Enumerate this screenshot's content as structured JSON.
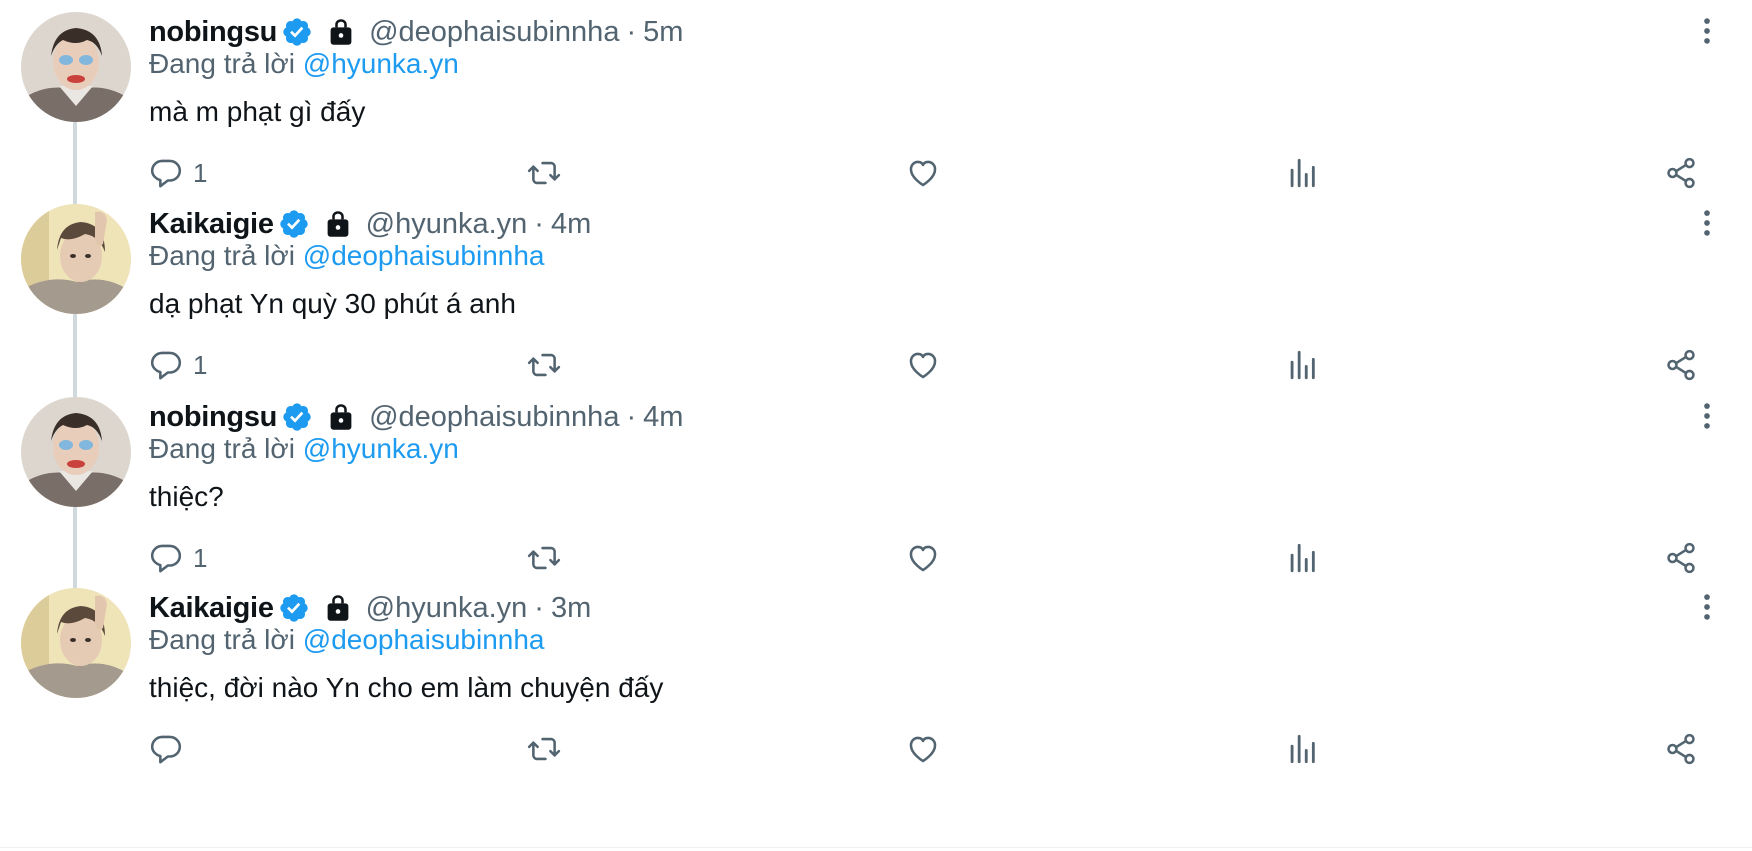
{
  "colors": {
    "accent": "#1d9bf0",
    "secondary_text": "#536471",
    "primary_text": "#0f1419",
    "thread_line": "#cfd9de"
  },
  "icons": {
    "verified": "verified-badge-icon",
    "protected": "lock-icon",
    "more": "more-vertical-icon",
    "reply": "reply-icon",
    "retweet": "retweet-icon",
    "like": "heart-icon",
    "views": "views-icon",
    "share": "share-icon"
  },
  "tweets": [
    {
      "display_name": "nobingsu",
      "handle": "@deophaisubinnha",
      "separator": "·",
      "time": "5m",
      "reply_prefix": "Đang trả lời",
      "reply_to": "@hyunka.yn",
      "text": "mà m phạt gì đấy",
      "reply_count": "1",
      "retweet_count": "",
      "like_count": "",
      "view_count": ""
    },
    {
      "display_name": "Kaikaigie",
      "handle": "@hyunka.yn",
      "separator": "·",
      "time": "4m",
      "reply_prefix": "Đang trả lời",
      "reply_to": "@deophaisubinnha",
      "text": "dạ phạt Yn quỳ 30 phút á anh",
      "reply_count": "1",
      "retweet_count": "",
      "like_count": "",
      "view_count": ""
    },
    {
      "display_name": "nobingsu",
      "handle": "@deophaisubinnha",
      "separator": "·",
      "time": "4m",
      "reply_prefix": "Đang trả lời",
      "reply_to": "@hyunka.yn",
      "text": "thiệc?",
      "reply_count": "1",
      "retweet_count": "",
      "like_count": "",
      "view_count": ""
    },
    {
      "display_name": "Kaikaigie",
      "handle": "@hyunka.yn",
      "separator": "·",
      "time": "3m",
      "reply_prefix": "Đang trả lời",
      "reply_to": "@deophaisubinnha",
      "text": "thiệc, đời nào Yn cho em làm chuyện đấy",
      "reply_count": "",
      "retweet_count": "",
      "like_count": "",
      "view_count": ""
    }
  ]
}
